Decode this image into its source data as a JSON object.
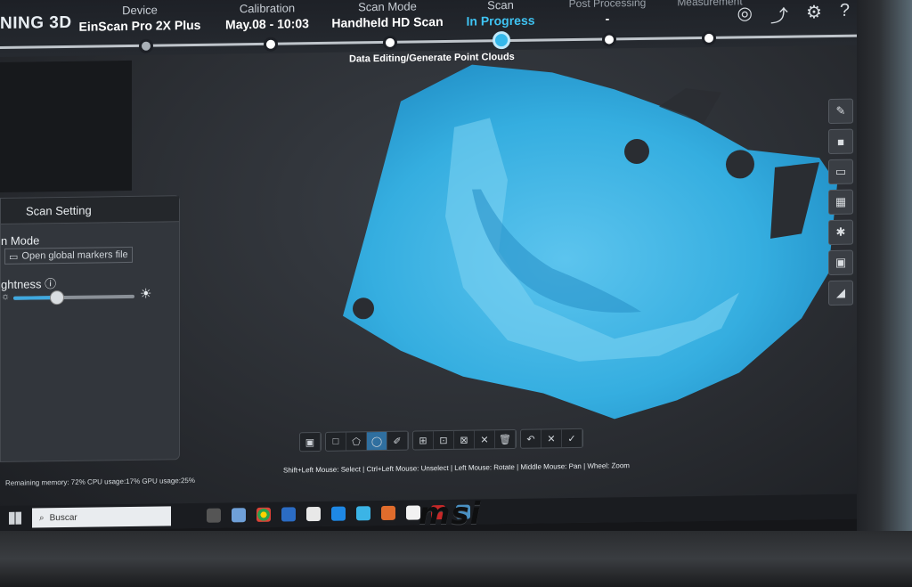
{
  "app": {
    "logo_text": "NING 3D"
  },
  "steps": [
    {
      "label": "Device",
      "value": "EinScan Pro 2X Plus"
    },
    {
      "label": "Calibration",
      "value": "May.08 - 10:03"
    },
    {
      "label": "Scan Mode",
      "value": "Handheld HD Scan"
    },
    {
      "label": "Scan",
      "value": "In Progress"
    },
    {
      "label": "Post Processing",
      "value": "-"
    },
    {
      "label": "Measurement",
      "value": ""
    }
  ],
  "status_subtitle": "Data Editing/Generate Point Clouds",
  "scan_setting": {
    "title": "Scan Setting",
    "mode_label": "n Mode",
    "open_markers_button": "Open global markers file",
    "brightness_label": "ghtness",
    "brightness_level": 0.35
  },
  "help_text": "Shift+Left Mouse: Select | Ctrl+Left Mouse: Unselect | Left Mouse: Rotate | Middle Mouse: Pan | Wheel: Zoom",
  "stats_text": "Remaining memory: 72%  CPU usage:17%  GPU usage:25%",
  "taskbar": {
    "search_placeholder": "Buscar"
  },
  "brand": "msi",
  "colors": {
    "accent": "#3fc3f2",
    "scan_blue": "#35aee0"
  },
  "icons": [
    "share-icon",
    "settings-icon",
    "help-icon",
    "eraser-icon",
    "stop-icon"
  ]
}
